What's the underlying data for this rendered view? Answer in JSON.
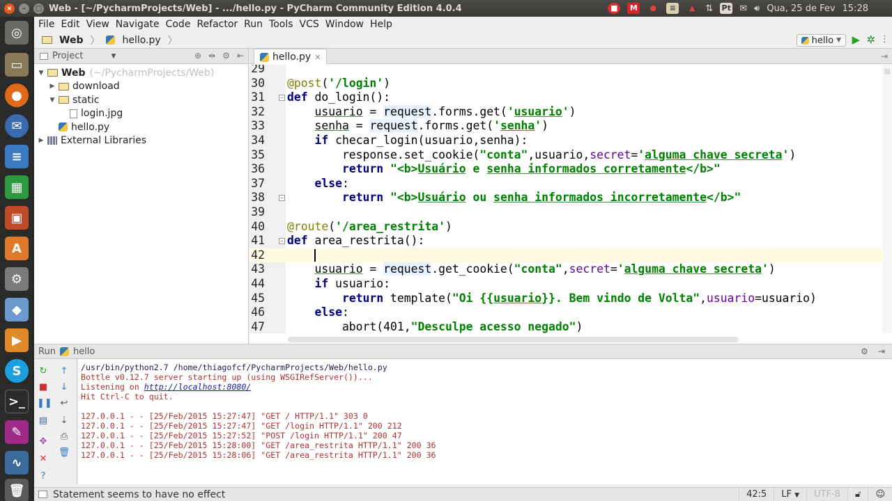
{
  "os_panel": {
    "window_title": "Web - [~/PycharmProjects/Web] - .../hello.py - PyCharm Community Edition 4.0.4",
    "pt_label": "Pt",
    "date": "Qua, 25 de Fev",
    "time": "15:28"
  },
  "launcher": {
    "items": [
      "dash-icon",
      "files-icon",
      "firefox-icon",
      "thunderbird-icon",
      "writer-icon",
      "calc-icon",
      "impress-icon",
      "software-center-icon",
      "settings-icon",
      "box-icon",
      "pycharm-icon",
      "skype-icon",
      "terminal-icon",
      "paint-icon",
      "monitor-icon",
      "trash-icon"
    ]
  },
  "menubar": [
    "File",
    "Edit",
    "View",
    "Navigate",
    "Code",
    "Refactor",
    "Run",
    "Tools",
    "VCS",
    "Window",
    "Help"
  ],
  "navbar": {
    "crumbs": [
      "Web",
      "hello.py"
    ],
    "run_config": "hello"
  },
  "project_panel": {
    "title": "Project",
    "tree": [
      {
        "label": "Web",
        "extra": "(~/PycharmProjects/Web)",
        "type": "folder",
        "level": 0,
        "arrow": "▼"
      },
      {
        "label": "download",
        "type": "folder",
        "level": 1,
        "arrow": "▶"
      },
      {
        "label": "static",
        "type": "folder",
        "level": 1,
        "arrow": "▼"
      },
      {
        "label": "login.jpg",
        "type": "file",
        "level": 2,
        "arrow": ""
      },
      {
        "label": "hello.py",
        "type": "py",
        "level": 1,
        "arrow": ""
      },
      {
        "label": "External Libraries",
        "type": "lib",
        "level": 0,
        "arrow": "▶"
      }
    ]
  },
  "editor": {
    "tab": "hello.py",
    "current_line": 42,
    "lines": [
      {
        "n": "29",
        "fold": "",
        "html": ""
      },
      {
        "n": "30",
        "fold": "",
        "html": "<span class=\"dec\">@post</span>(<span class=\"str\">'/login'</span>)"
      },
      {
        "n": "31",
        "fold": "⊖",
        "html": "<span class=\"kw\">def</span> do_login():"
      },
      {
        "n": "32",
        "fold": "",
        "html": "    <span class=\"u\">usuario</span> = <span class=\"hl\">request</span>.forms.get(<span class=\"str\">'<span class=\"u\">usuario</span>'</span>)"
      },
      {
        "n": "33",
        "fold": "",
        "html": "    <span class=\"u\">senha</span> = <span class=\"hl\">request</span>.forms.get(<span class=\"str\">'<span class=\"u\">senha</span>'</span>)"
      },
      {
        "n": "34",
        "fold": "",
        "html": "    <span class=\"kw\">if</span> checar_login(usuario,senha):"
      },
      {
        "n": "35",
        "fold": "",
        "html": "        response.set_cookie(<span class=\"str\">\"conta\"</span>,usuario,<span class=\"param\">secret</span>=<span class=\"str\">'<span class=\"u\">alguma chave secreta</span>'</span>)"
      },
      {
        "n": "36",
        "fold": "",
        "html": "        <span class=\"kw\">return</span> <span class=\"str\">\"&lt;b&gt;<span class=\"u\">Usuário</span> e <span class=\"u\">senha informados corretamente</span>&lt;/b&gt;\"</span>"
      },
      {
        "n": "37",
        "fold": "",
        "html": "    <span class=\"kw\">else</span>:"
      },
      {
        "n": "38",
        "fold": "⊖",
        "html": "        <span class=\"kw\">return</span> <span class=\"str\">\"&lt;b&gt;<span class=\"u\">Usuário</span> ou <span class=\"u\">senha informados incorretamente</span>&lt;/b&gt;\"</span>"
      },
      {
        "n": "39",
        "fold": "",
        "html": ""
      },
      {
        "n": "40",
        "fold": "",
        "html": "<span class=\"dec\">@route</span>(<span class=\"str\">'/area_restrita'</span>)"
      },
      {
        "n": "41",
        "fold": "⊖",
        "html": "<span class=\"kw\">def</span> area_restrita():"
      },
      {
        "n": "42",
        "fold": "",
        "html": "    <span class=\"caret-bar\"></span>"
      },
      {
        "n": "43",
        "fold": "",
        "html": "    <span class=\"u\">usuario</span> = <span class=\"hl\">request</span>.get_cookie(<span class=\"str\">\"conta\"</span>,<span class=\"param\">secret</span>=<span class=\"str\">'<span class=\"u\">alguma chave secreta</span>'</span>)"
      },
      {
        "n": "44",
        "fold": "",
        "html": "    <span class=\"kw\">if</span> usuario:"
      },
      {
        "n": "45",
        "fold": "",
        "html": "        <span class=\"kw\">return</span> template(<span class=\"str\">\"Oi {{<span class=\"u\">usuario</span>}}. Bem vindo de Volta\"</span>,<span class=\"param\">usuario</span>=usuario)"
      },
      {
        "n": "46",
        "fold": "",
        "html": "    <span class=\"kw\">else</span>:"
      },
      {
        "n": "47",
        "fold": "",
        "html": "        abort(401,<span class=\"str\">\"Desculpe acesso negado\"</span>)"
      }
    ]
  },
  "run_panel": {
    "label": "Run",
    "config": "hello",
    "console": [
      {
        "cls": "c-blk",
        "text": "/usr/bin/python2.7 /home/thiagofcf/PycharmProjects/Web/hello.py"
      },
      {
        "cls": "c-red",
        "text": "Bottle v0.12.7 server starting up (using WSGIRefServer())..."
      },
      {
        "cls": "c-red",
        "text": "Listening on ",
        "link": "http://localhost:8080/"
      },
      {
        "cls": "c-red",
        "text": "Hit Ctrl-C to quit."
      },
      {
        "cls": "c-gap",
        "text": ""
      },
      {
        "cls": "c-red",
        "text": "127.0.0.1 - - [25/Feb/2015 15:27:47] \"GET / HTTP/1.1\" 303 0"
      },
      {
        "cls": "c-red",
        "text": "127.0.0.1 - - [25/Feb/2015 15:27:47] \"GET /login HTTP/1.1\" 200 212"
      },
      {
        "cls": "c-red",
        "text": "127.0.0.1 - - [25/Feb/2015 15:27:52] \"POST /login HTTP/1.1\" 200 47"
      },
      {
        "cls": "c-red",
        "text": "127.0.0.1 - - [25/Feb/2015 15:28:00] \"GET /area_restrita HTTP/1.1\" 200 36"
      },
      {
        "cls": "c-red",
        "text": "127.0.0.1 - - [25/Feb/2015 15:28:06] \"GET /area_restrita HTTP/1.1\" 200 36"
      }
    ]
  },
  "statusbar": {
    "message": "Statement seems to have no effect",
    "position": "42:5",
    "line_sep": "LF",
    "encoding": "UTF-8"
  }
}
